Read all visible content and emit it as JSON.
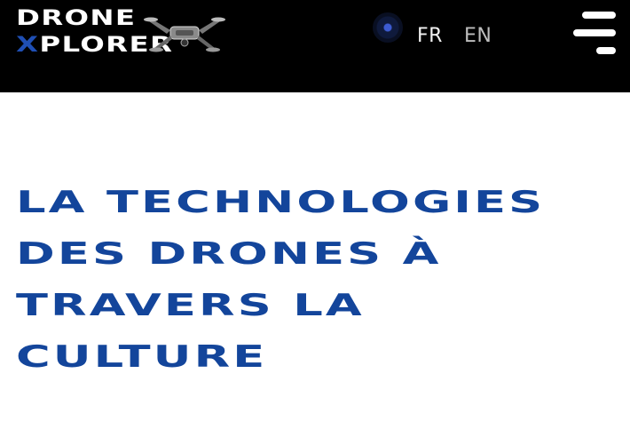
{
  "header": {
    "logo": {
      "line1": "DRONE",
      "line2_first": "X",
      "line2_rest": "PLORER",
      "drone_icon": "drone-icon"
    },
    "indicator_icon": "dot-icon",
    "lang_fr": "FR",
    "lang_en": "EN",
    "menu_icon": "hamburger-menu-icon"
  },
  "hero": {
    "title_lines": [
      "LA TECHNOLOGIES",
      "DES DRONES À",
      "TRAVERS LA",
      "CULTURE"
    ],
    "color": "#13459b"
  },
  "colors": {
    "header_bg": "#000000",
    "page_bg": "#ffffff",
    "accent": "#1f4fb5"
  }
}
